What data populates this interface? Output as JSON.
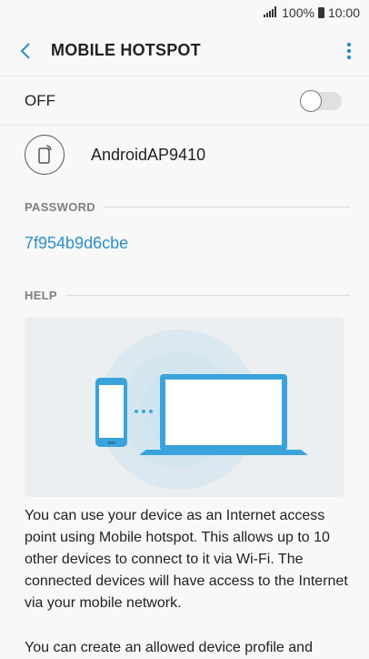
{
  "status_bar": {
    "battery": "100%",
    "time": "10:00"
  },
  "header": {
    "title": "MOBILE HOTSPOT"
  },
  "toggle": {
    "label": "OFF",
    "state": "off"
  },
  "network": {
    "name": "AndroidAP9410"
  },
  "password_section": {
    "header": "PASSWORD",
    "value": "7f954b9d6cbe"
  },
  "help_section": {
    "header": "HELP",
    "paragraph1": "You can use your device as an Internet access point using Mobile hotspot. This allows up to 10 other devices to connect to it via Wi-Fi. The connected devices will have access to the Internet via your mobile network.",
    "paragraph2": "You can create an allowed device profile and"
  },
  "colors": {
    "accent": "#2a8fc6",
    "illustration_bg": "#eceff1",
    "device_blue": "#3aa3db"
  },
  "icons": {
    "back": "chevron-left-icon",
    "more": "more-vert-icon",
    "signal": "signal-icon",
    "battery": "battery-icon",
    "hotspot": "hotspot-phone-icon"
  }
}
